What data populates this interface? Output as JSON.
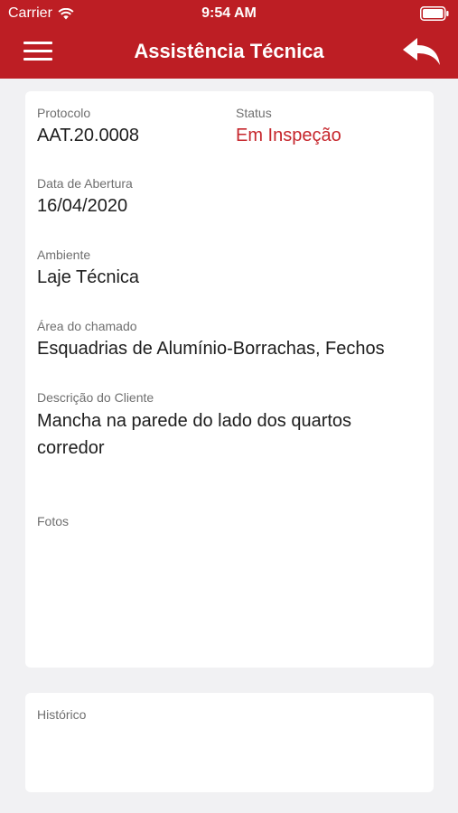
{
  "status_bar": {
    "carrier": "Carrier",
    "time": "9:54 AM"
  },
  "navbar": {
    "title": "Assistência Técnica",
    "menu_icon": "hamburger-menu-icon",
    "back_icon": "reply-back-arrow-icon"
  },
  "colors": {
    "brand_red": "#bd1e24",
    "status_red": "#c6262c",
    "background": "#f1f1f3"
  },
  "details": {
    "protocolo": {
      "label": "Protocolo",
      "value": "AAT.20.0008"
    },
    "status": {
      "label": "Status",
      "value": "Em Inspeção"
    },
    "data_abertura": {
      "label": "Data de Abertura",
      "value": "16/04/2020"
    },
    "ambiente": {
      "label": "Ambiente",
      "value": "Laje Técnica"
    },
    "area_chamado": {
      "label": "Área do chamado",
      "value": "Esquadrias de Alumínio-Borrachas, Fechos"
    },
    "descricao": {
      "label": "Descrição do Cliente",
      "value": "Mancha na parede do lado dos quartos corredor"
    },
    "fotos": {
      "label": "Fotos"
    }
  },
  "historico": {
    "label": "Histórico"
  }
}
